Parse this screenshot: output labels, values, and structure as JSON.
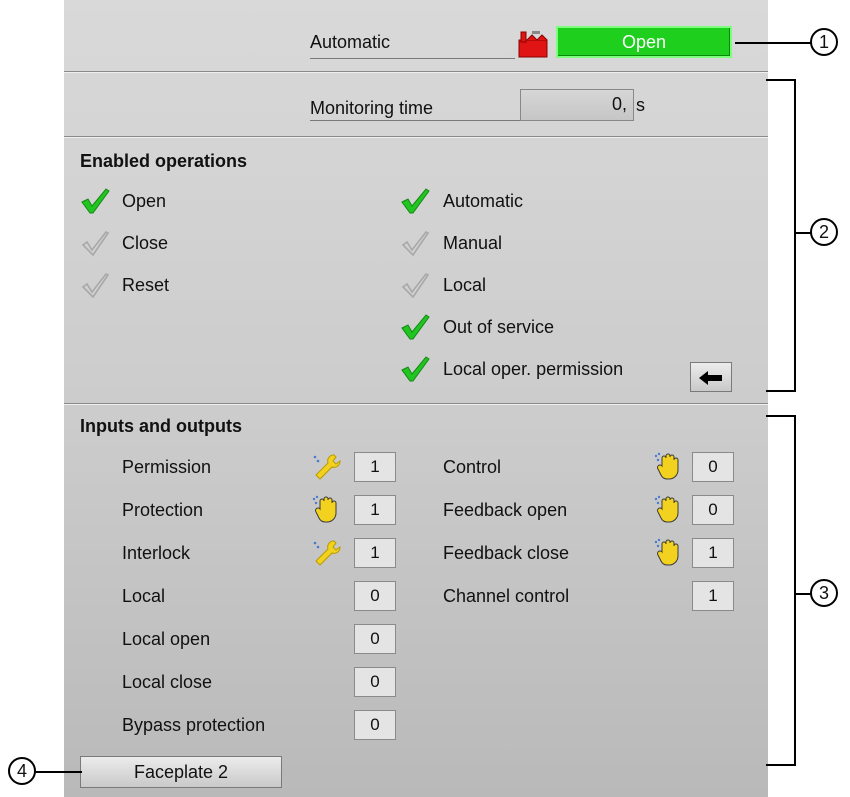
{
  "header": {
    "mode_label": "Automatic",
    "status": "Open"
  },
  "monitoring": {
    "label": "Monitoring time",
    "value": "0,",
    "unit": "s"
  },
  "enabled_operations": {
    "title": "Enabled operations",
    "left": [
      {
        "label": "Open",
        "enabled": true
      },
      {
        "label": "Close",
        "enabled": false
      },
      {
        "label": "Reset",
        "enabled": false
      }
    ],
    "right": [
      {
        "label": "Automatic",
        "enabled": true
      },
      {
        "label": "Manual",
        "enabled": false
      },
      {
        "label": "Local",
        "enabled": false
      },
      {
        "label": "Out of service",
        "enabled": true
      },
      {
        "label": "Local oper. permission",
        "enabled": true
      }
    ]
  },
  "inputs_outputs": {
    "title": "Inputs and outputs",
    "left": [
      {
        "label": "Permission",
        "value": "1",
        "icon": "wrench-icon"
      },
      {
        "label": "Protection",
        "value": "1",
        "icon": "hand-icon"
      },
      {
        "label": "Interlock",
        "value": "1",
        "icon": "wrench-icon"
      },
      {
        "label": "Local",
        "value": "0",
        "icon": ""
      },
      {
        "label": "Local open",
        "value": "0",
        "icon": ""
      },
      {
        "label": "Local close",
        "value": "0",
        "icon": ""
      },
      {
        "label": "Bypass protection",
        "value": "0",
        "icon": ""
      }
    ],
    "right": [
      {
        "label": "Control",
        "value": "0",
        "icon": "hand-icon"
      },
      {
        "label": "Feedback open",
        "value": "0",
        "icon": "hand-icon"
      },
      {
        "label": "Feedback close",
        "value": "1",
        "icon": "hand-icon"
      },
      {
        "label": "Channel control",
        "value": "1",
        "icon": ""
      }
    ]
  },
  "footer": {
    "faceplate_button": "Faceplate 2"
  },
  "callouts": [
    "1",
    "2",
    "3",
    "4"
  ],
  "colors": {
    "status_green": "#1ecf1e",
    "check_enabled": "#22c422",
    "check_disabled": "#b0b0b0",
    "icon_yellow": "#f2d21e"
  }
}
